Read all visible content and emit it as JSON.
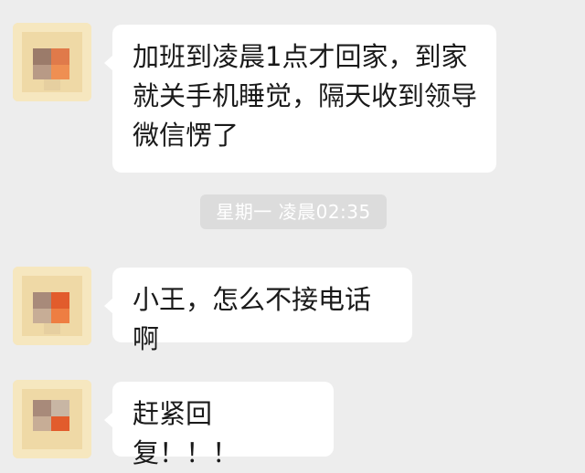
{
  "chat": {
    "messages": [
      {
        "text": "加班到凌晨1点才回家，到家就关手机睡觉，隔天收到领导微信愣了"
      },
      {
        "text": "小王，怎么不接电话啊"
      },
      {
        "text": "赶紧回复！！！"
      }
    ],
    "timestamp": "星期一 凌晨02:35"
  },
  "colors": {
    "background": "#ededed",
    "bubble": "#ffffff",
    "timestamp_bg": "#dcdcdc",
    "avatar_base": "#f4e3b4",
    "avatar_accent": "#e8733a"
  },
  "icons": {
    "avatar": "pixelated-avatar-icon"
  }
}
